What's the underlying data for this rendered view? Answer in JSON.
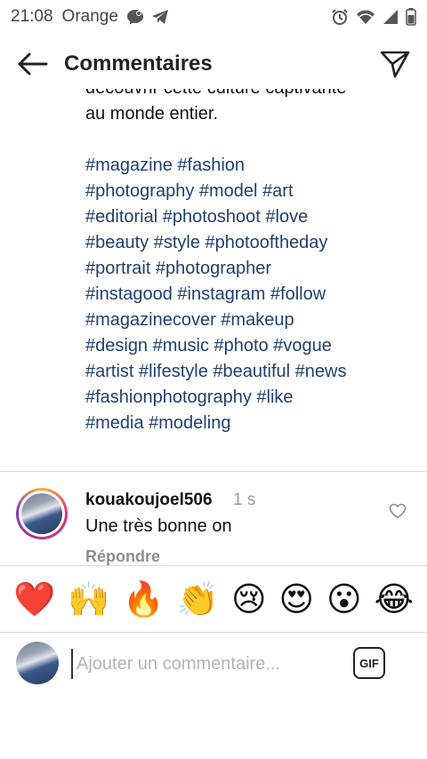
{
  "status_bar": {
    "time": "21:08",
    "carrier": "Orange"
  },
  "header": {
    "title": "Commentaires"
  },
  "caption": {
    "lines": [
      "découvrir cette culture captivante",
      "au monde entier."
    ],
    "hashtag_lines": [
      "#magazine #fashion",
      "#photography #model #art",
      "#editorial #photoshoot #love",
      "#beauty #style #photooftheday",
      "#portrait #photographer",
      "#instagood #instagram #follow",
      "#magazinecover #makeup",
      "#design #music #photo #vogue",
      "#artist #lifestyle #beautiful #news",
      "#fashionphotography #like",
      "#media #modeling"
    ],
    "hashtag_color": "#1e3f73"
  },
  "comment": {
    "username": "kouakoujoel506",
    "time": "1 s",
    "text": "Une très bonne on",
    "reply_label": "Répondre"
  },
  "emojis": [
    "❤️",
    "🙌",
    "🔥",
    "👏",
    "😢",
    "😍",
    "😮",
    "😂"
  ],
  "composer": {
    "placeholder": "Ajouter un commentaire...",
    "gif_label": "GIF"
  }
}
